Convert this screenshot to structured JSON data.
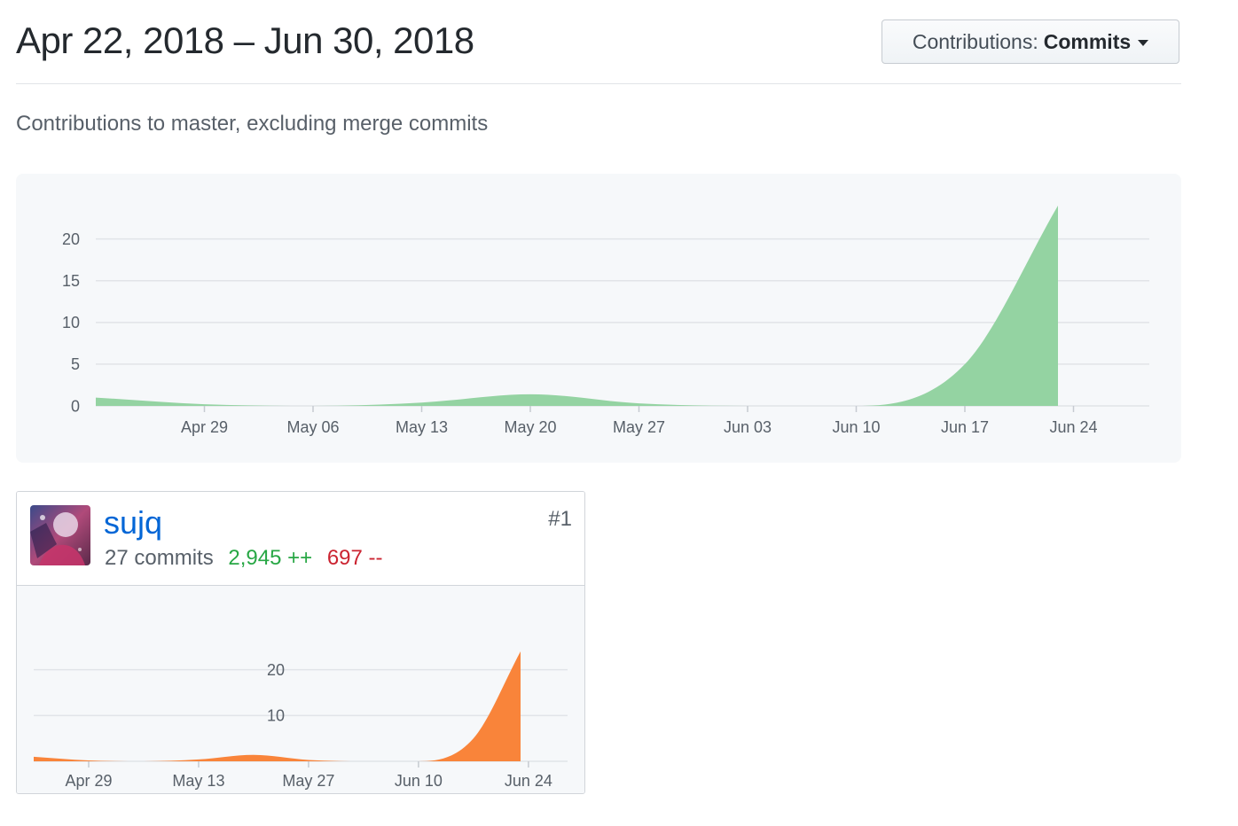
{
  "header": {
    "date_range": "Apr 22, 2018 – Jun 30, 2018",
    "contributions_prefix": "Contributions:",
    "contributions_value": "Commits",
    "subtitle": "Contributions to master, excluding merge commits"
  },
  "colors": {
    "main_area": "#94d3a2",
    "user_area": "#f9843a",
    "link": "#0366d6",
    "additions": "#28a745",
    "deletions": "#cb2431"
  },
  "chart_data": [
    {
      "type": "area",
      "title": "",
      "x_tick_labels": [
        "Apr 29",
        "May 06",
        "May 13",
        "May 20",
        "May 27",
        "Jun 03",
        "Jun 10",
        "Jun 17",
        "Jun 24"
      ],
      "y_tick_labels": [
        "0",
        "5",
        "10",
        "15",
        "20"
      ],
      "ylim": [
        0,
        24
      ],
      "grid": true,
      "series": [
        {
          "x": [
            "2018-04-22",
            "2018-04-29",
            "2018-05-06",
            "2018-05-13",
            "2018-05-20",
            "2018-05-27",
            "2018-06-03",
            "2018-06-10",
            "2018-06-17",
            "2018-06-23"
          ],
          "values": [
            1,
            0.2,
            0,
            0.4,
            1.4,
            0.3,
            0,
            0,
            5,
            24
          ]
        }
      ]
    },
    {
      "type": "area",
      "title": "",
      "x_tick_labels": [
        "Apr 29",
        "May 13",
        "May 27",
        "Jun 10",
        "Jun 24"
      ],
      "y_tick_labels": [
        "10",
        "20"
      ],
      "ylim": [
        0,
        24
      ],
      "grid": true,
      "series": [
        {
          "x": [
            "2018-04-22",
            "2018-04-29",
            "2018-05-06",
            "2018-05-13",
            "2018-05-20",
            "2018-05-27",
            "2018-06-03",
            "2018-06-10",
            "2018-06-17",
            "2018-06-23"
          ],
          "values": [
            1,
            0.2,
            0,
            0.4,
            1.4,
            0.3,
            0,
            0,
            5,
            24
          ]
        }
      ]
    }
  ],
  "user": {
    "name": "sujq",
    "commits": "27 commits",
    "additions": "2,945 ++",
    "deletions": "697 --",
    "rank": "#1"
  }
}
